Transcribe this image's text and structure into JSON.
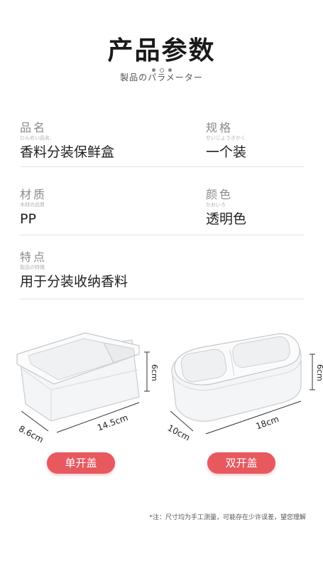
{
  "header": {
    "title": "产品参数",
    "subtitle": "製品のパラメーター"
  },
  "specs": {
    "name": {
      "label": "品名",
      "ruby": "ひんめい品名:",
      "value": "香料分装保鲜盒"
    },
    "size": {
      "label": "规格",
      "ruby": "せいじょうきかく",
      "value": "一个装"
    },
    "material": {
      "label": "材质",
      "ruby": "木材の品質",
      "value": "PP"
    },
    "color": {
      "label": "颜色",
      "ruby": "かおいろ",
      "value": "透明色"
    },
    "feature": {
      "label": "特点",
      "ruby": "製品の特徴",
      "value": "用于分装收纳香料"
    }
  },
  "products": [
    {
      "badge": "单开盖",
      "height": "6cm",
      "width": "8.6cm",
      "length": "14.5cm"
    },
    {
      "badge": "双开盖",
      "height": "6cm",
      "width": "10cm",
      "length": "18cm"
    }
  ],
  "note": "*注：尺寸均为手工测量，可能存在少许误差，望您理解",
  "colors": {
    "accent": "#e8585f",
    "label": "#8a8a8a",
    "divider": "#e3e3e3"
  }
}
